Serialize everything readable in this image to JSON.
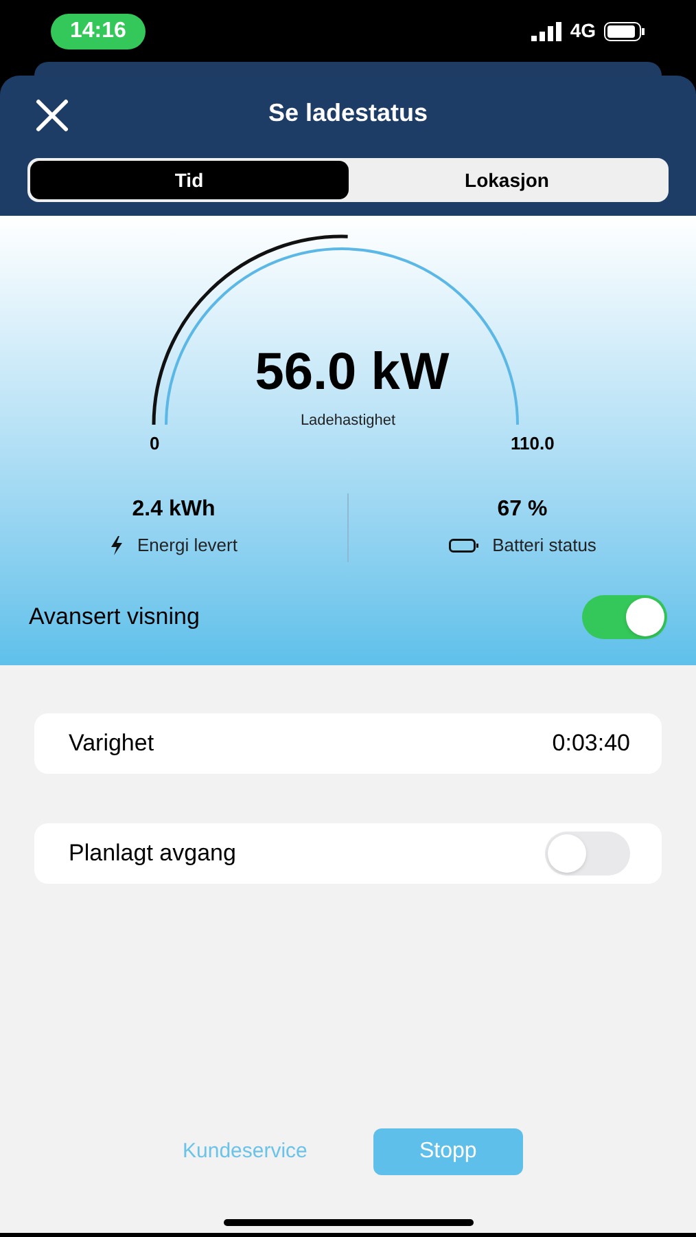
{
  "status_bar": {
    "time": "14:16",
    "network": "4G"
  },
  "header": {
    "title": "Se ladestatus"
  },
  "tabs": [
    {
      "label": "Tid",
      "selected": true
    },
    {
      "label": "Lokasjon",
      "selected": false
    }
  ],
  "gauge": {
    "value": "56.0 kW",
    "label": "Ladehastighet",
    "min": "0",
    "max": "110.0",
    "level": 0.51
  },
  "stats": [
    {
      "value": "2.4 kWh",
      "label": "Energi levert",
      "kind": "energy"
    },
    {
      "value": "67 %",
      "label": "Batteri status",
      "kind": "battery"
    }
  ],
  "advanced_view": {
    "label": "Avansert visning",
    "on": true
  },
  "rows": [
    {
      "kind": "value",
      "label": "Varighet",
      "value": "0:03:40"
    },
    {
      "kind": "toggle",
      "label": "Planlagt avgang",
      "on": false
    }
  ],
  "footer": {
    "link": "Kundeservice",
    "button": "Stopp"
  }
}
